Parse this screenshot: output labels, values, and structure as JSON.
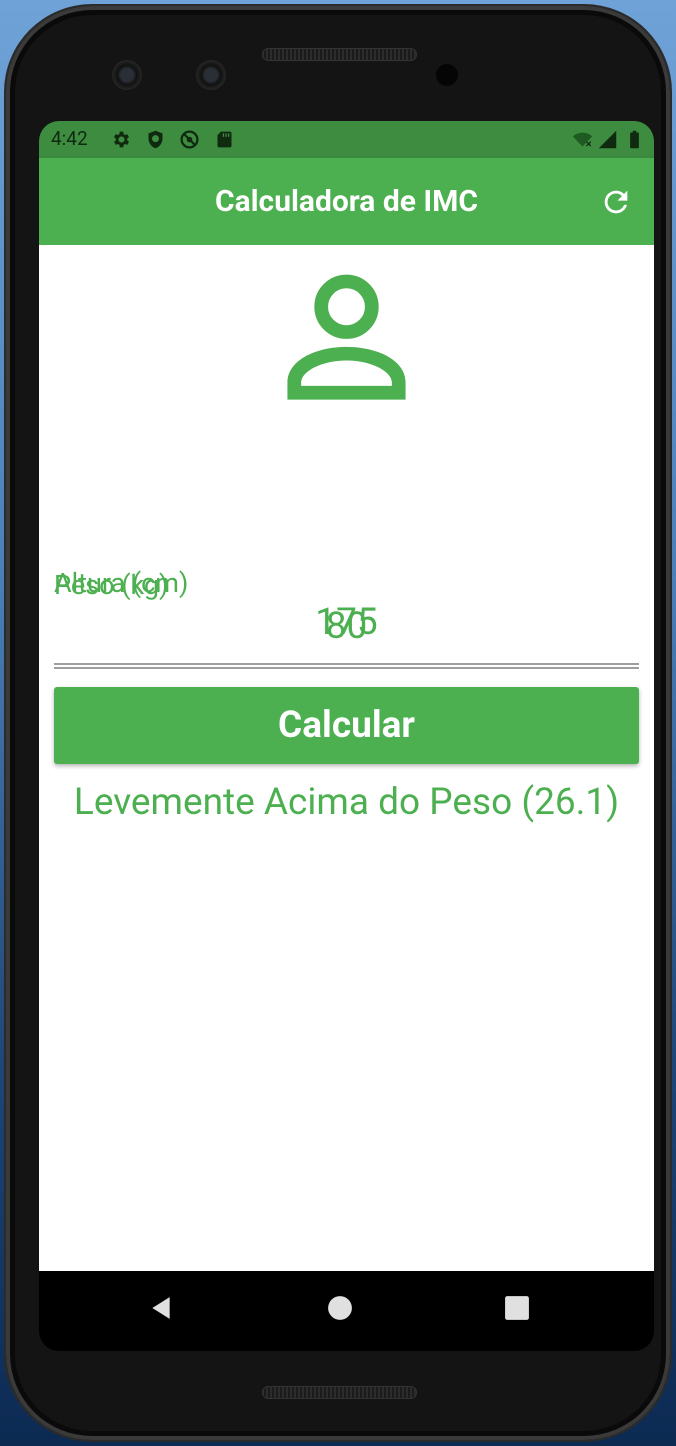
{
  "status_bar": {
    "time": "4:42",
    "icons": [
      "settings-icon",
      "shield-icon",
      "do-not-disturb-icon",
      "sd-card-icon",
      "wifi-off-icon",
      "cell-signal-icon",
      "battery-icon"
    ]
  },
  "app_bar": {
    "title": "Calculadora de IMC",
    "action_icon": "refresh-icon"
  },
  "form": {
    "avatar_icon": "person-outline-icon",
    "weight": {
      "label": "Peso (kg)",
      "value": "80"
    },
    "height": {
      "label": "Altura (cm)",
      "value": "175"
    },
    "submit_label": "Calcular"
  },
  "result": {
    "text": "Levemente Acima do Peso (26.1)"
  },
  "nav_bar": {
    "buttons": [
      "back-icon",
      "home-icon",
      "recents-icon"
    ]
  },
  "colors": {
    "primary": "#4caf50",
    "status_bar": "#3d8c40",
    "text_on_primary": "#ffffff",
    "divider": "#9e9e9e"
  }
}
